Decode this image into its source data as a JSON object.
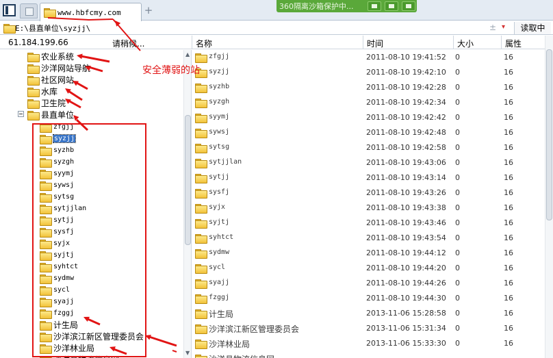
{
  "tabs": {
    "active_url": "www.hbfcmy.com",
    "new_tab": "+"
  },
  "sandbox": {
    "label": "360隔离沙箱保护中..."
  },
  "address": {
    "path": "E:\\县直单位\\syzjj\\",
    "plus_minus": "±",
    "dropdown": "▾",
    "goto_label": "读取中"
  },
  "header": {
    "server_ip": "61.184.199.66",
    "wait_text": "请稍候...",
    "col_name": "名称",
    "col_time": "时间",
    "col_size": "大小",
    "col_attr": "属性"
  },
  "tree": {
    "top_items": [
      {
        "label": "农业系统"
      },
      {
        "label": "沙洋网站导航"
      },
      {
        "label": "社区网站"
      },
      {
        "label": "水库"
      },
      {
        "label": "卫生院"
      },
      {
        "label": "县直单位"
      }
    ],
    "children": [
      {
        "label": "zfgjj"
      },
      {
        "label": "syzjj",
        "selected": true
      },
      {
        "label": "syzhb"
      },
      {
        "label": "syzgh"
      },
      {
        "label": "syymj"
      },
      {
        "label": "sywsj"
      },
      {
        "label": "sytsg"
      },
      {
        "label": "sytjjlan"
      },
      {
        "label": "sytjj"
      },
      {
        "label": "sysfj"
      },
      {
        "label": "syjx"
      },
      {
        "label": "syjtj"
      },
      {
        "label": "syhtct"
      },
      {
        "label": "sydmw"
      },
      {
        "label": "sycl"
      },
      {
        "label": "syajj"
      },
      {
        "label": "fzggj"
      },
      {
        "label": "计生局"
      },
      {
        "label": "沙洋滨江新区管理委员会"
      },
      {
        "label": "沙洋林业局"
      },
      {
        "label": "沙洋县物流信息网"
      }
    ]
  },
  "files": [
    {
      "name": "zfgjj",
      "time": "2011-08-10 19:41:52",
      "size": "0",
      "attr": "16"
    },
    {
      "name": "syzjj",
      "time": "2011-08-10 19:42:10",
      "size": "0",
      "attr": "16"
    },
    {
      "name": "syzhb",
      "time": "2011-08-10 19:42:28",
      "size": "0",
      "attr": "16"
    },
    {
      "name": "syzgh",
      "time": "2011-08-10 19:42:34",
      "size": "0",
      "attr": "16"
    },
    {
      "name": "syymj",
      "time": "2011-08-10 19:42:42",
      "size": "0",
      "attr": "16"
    },
    {
      "name": "sywsj",
      "time": "2011-08-10 19:42:48",
      "size": "0",
      "attr": "16"
    },
    {
      "name": "sytsg",
      "time": "2011-08-10 19:42:58",
      "size": "0",
      "attr": "16"
    },
    {
      "name": "sytjjlan",
      "time": "2011-08-10 19:43:06",
      "size": "0",
      "attr": "16"
    },
    {
      "name": "sytjj",
      "time": "2011-08-10 19:43:14",
      "size": "0",
      "attr": "16"
    },
    {
      "name": "sysfj",
      "time": "2011-08-10 19:43:26",
      "size": "0",
      "attr": "16"
    },
    {
      "name": "syjx",
      "time": "2011-08-10 19:43:38",
      "size": "0",
      "attr": "16"
    },
    {
      "name": "syjtj",
      "time": "2011-08-10 19:43:46",
      "size": "0",
      "attr": "16"
    },
    {
      "name": "syhtct",
      "time": "2011-08-10 19:43:54",
      "size": "0",
      "attr": "16"
    },
    {
      "name": "sydmw",
      "time": "2011-08-10 19:44:12",
      "size": "0",
      "attr": "16"
    },
    {
      "name": "sycl",
      "time": "2011-08-10 19:44:20",
      "size": "0",
      "attr": "16"
    },
    {
      "name": "syajj",
      "time": "2011-08-10 19:44:26",
      "size": "0",
      "attr": "16"
    },
    {
      "name": "fzggj",
      "time": "2011-08-10 19:44:30",
      "size": "0",
      "attr": "16"
    },
    {
      "name": "计生局",
      "time": "2013-11-06 15:28:58",
      "size": "0",
      "attr": "16"
    },
    {
      "name": "沙洋滨江新区管理委员会",
      "time": "2013-11-06 15:31:34",
      "size": "0",
      "attr": "16"
    },
    {
      "name": "沙洋林业局",
      "time": "2013-11-06 15:33:30",
      "size": "0",
      "attr": "16"
    },
    {
      "name": "沙洋县物流信息网",
      "time": "",
      "size": "",
      "attr": ""
    }
  ],
  "annotation": {
    "text": "安全薄弱的站",
    "color": "#e11414"
  },
  "icons": {
    "folder": "folder-icon",
    "panel_toggle": "panel-toggle-icon",
    "arrow": "red-arrow-annotation"
  }
}
